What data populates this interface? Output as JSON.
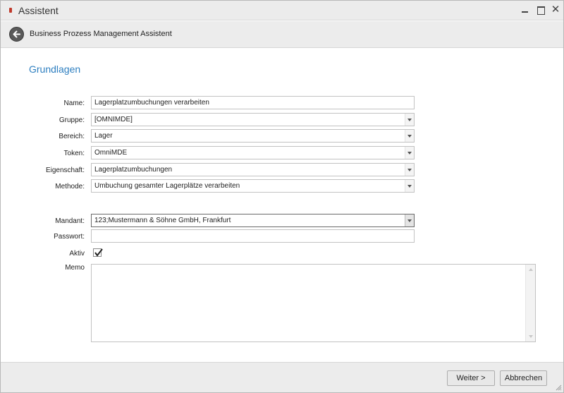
{
  "window": {
    "title": "Assistent"
  },
  "header": {
    "title": "Business Prozess Management Assistent"
  },
  "section": {
    "title": "Grundlagen"
  },
  "form": {
    "name": {
      "label": "Name:",
      "value": "Lagerplatzumbuchungen verarbeiten"
    },
    "gruppe": {
      "label": "Gruppe:",
      "value": "[OMNIMDE]"
    },
    "bereich": {
      "label": "Bereich:",
      "value": "Lager"
    },
    "token": {
      "label": "Token:",
      "value": "OmniMDE"
    },
    "eigenschaft": {
      "label": "Eigenschaft:",
      "value": "Lagerplatzumbuchungen"
    },
    "methode": {
      "label": "Methode:",
      "value": "Umbuchung gesamter Lagerplätze verarbeiten"
    },
    "mandant": {
      "label": "Mandant:",
      "value": "123;Mustermann & Söhne GmbH, Frankfurt"
    },
    "passwort": {
      "label": "Passwort:",
      "value": ""
    },
    "aktiv": {
      "label": "Aktiv",
      "checked": true
    },
    "memo": {
      "label": "Memo",
      "value": ""
    }
  },
  "footer": {
    "next_label": "Weiter >",
    "cancel_label": "Abbrechen"
  },
  "icons": {
    "window": "app-icon",
    "back": "back-arrow-icon",
    "check": "checkmark-icon"
  },
  "colors": {
    "accent": "#2e7fc0",
    "chrome": "#ececec"
  }
}
